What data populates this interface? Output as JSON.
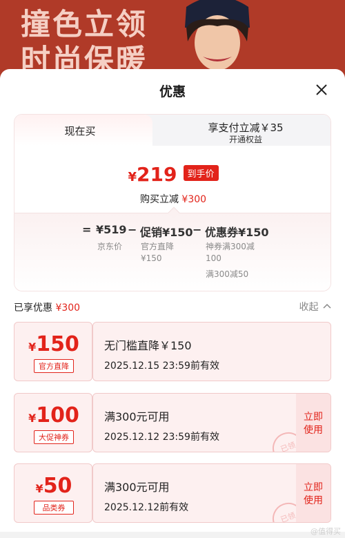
{
  "banner": {
    "text_line1": "撞色立领",
    "text_line2": "时尚保暖"
  },
  "sheet": {
    "title": "优惠",
    "close_icon": "close-icon"
  },
  "calc": {
    "tab_current": "现在买",
    "tab_alt_title": "享支付立减￥35",
    "tab_alt_sub": "开通权益",
    "price_symbol": "¥",
    "price_value": "219",
    "price_tag": "到手价",
    "instant_label": "购买立减",
    "instant_amount": "¥300",
    "breakdown": {
      "eq": "=",
      "jd_price": "¥519",
      "jd_label": "京东价",
      "minus1": "−",
      "promo": "促销¥150",
      "promo_sub1": "官方直降",
      "promo_sub2": "¥150",
      "minus2": "−",
      "coupon": "优惠券¥150",
      "coupon_sub1": "神券满300减",
      "coupon_sub2": "100",
      "coupon_sub3": "满300减50"
    }
  },
  "enjoyed": {
    "label": "已享优惠",
    "amount": "¥300",
    "collapse": "收起"
  },
  "coupons": [
    {
      "symbol": "¥",
      "amount": "150",
      "badge": "官方直降",
      "title": "无门槛直降￥150",
      "date": "2025.12.15 23:59前有效"
    },
    {
      "symbol": "¥",
      "amount": "100",
      "badge": "大促神券",
      "title": "满300元可用",
      "date": "2025.12.12 23:59前有效",
      "use_line1": "立即",
      "use_line2": "使用",
      "stamp": "已领"
    },
    {
      "symbol": "¥",
      "amount": "50",
      "badge": "品类券",
      "title": "满300元可用",
      "date": "2025.12.12前有效",
      "use_line1": "立即",
      "use_line2": "使用",
      "stamp": "已领"
    }
  ],
  "watermark": "@值得买"
}
